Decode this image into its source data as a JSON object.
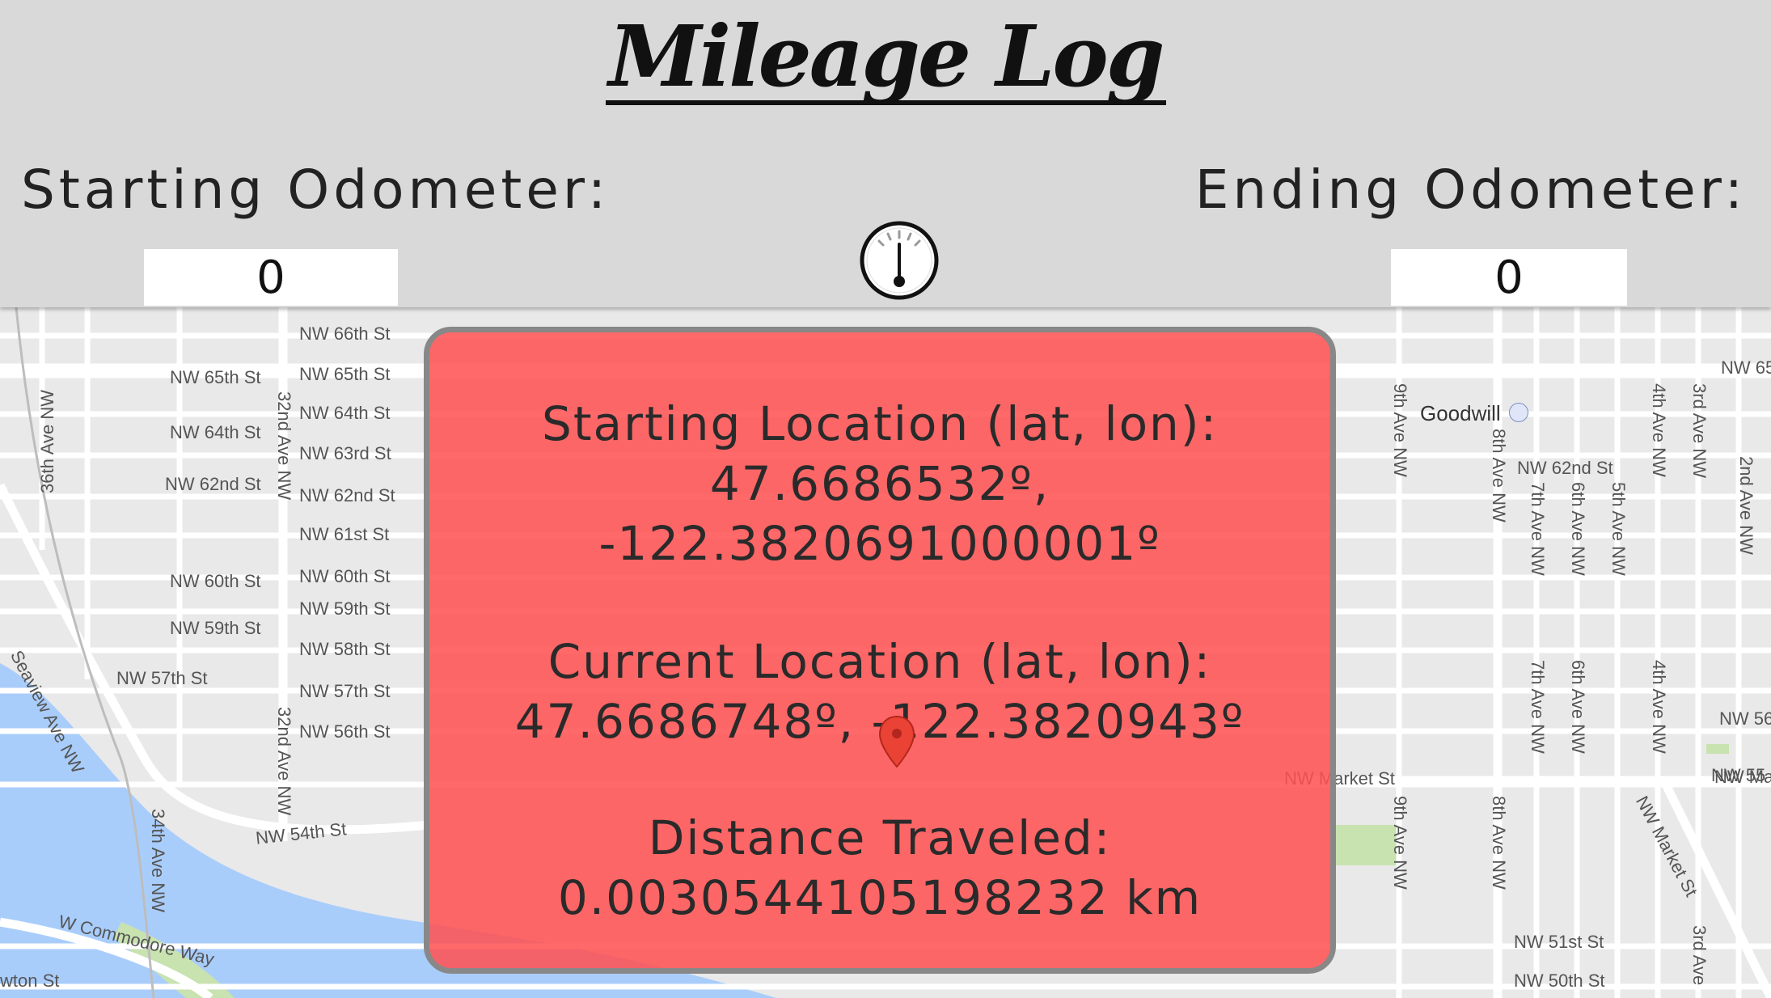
{
  "header": {
    "title": "Mileage Log",
    "starting_odometer_label": "Starting Odometer:",
    "ending_odometer_label": "Ending Odometer:",
    "starting_odometer_value": "0",
    "ending_odometer_value": "0",
    "gauge_icon": "gauge-icon"
  },
  "info": {
    "starting_location_label": "Starting Location (lat, lon):",
    "starting_lat": "47.6686532º,",
    "starting_lon": "-122.3820691000001º",
    "current_location_label": "Current Location (lat, lon):",
    "current_coords": "47.6686748º, -122.3820943º",
    "distance_label": "Distance Traveled:",
    "distance_value": "0.0030544105198232 km"
  },
  "map": {
    "marker_icon": "map-pin-icon",
    "labels": [
      "NW 66th St",
      "NW 65th St",
      "NW 65th St",
      "NW 64th St",
      "NW 64th St",
      "NW 63rd St",
      "NW 62nd St",
      "NW 62nd St",
      "NW 61st St",
      "NW 60th St",
      "NW 60th St",
      "NW 59th St",
      "NW 59th St",
      "NW 58th St",
      "NW 57th St",
      "NW 57th St",
      "NW 56th St",
      "NW 54th St",
      "W Commodore Way",
      "wton St",
      "36th Ave NW",
      "34th Ave NW",
      "32nd Ave NW",
      "32nd Ave NW",
      "Seaview Ave NW",
      "Goodwill",
      "NW 62nd St",
      "9th Ave NW",
      "8th Ave NW",
      "7th Ave NW",
      "6th Ave NW",
      "5th Ave NW",
      "4th Ave NW",
      "3rd Ave NW",
      "2nd Ave NW",
      "NW Market St",
      "NW Market St",
      "NW 51st St",
      "NW 50th St",
      "NW Market St",
      "9th Ave NW",
      "8th Ave NW",
      "7th Ave NW",
      "6th Ave NW",
      "4th Ave NW",
      "3rd Ave",
      "NW 55",
      "NW 56",
      "NW 65"
    ]
  },
  "colors": {
    "header_bg": "#d9d9d9",
    "panel_fill": "#ff5050",
    "panel_border": "#888888",
    "water": "#a9cdfb",
    "park": "#c8e2b0"
  }
}
